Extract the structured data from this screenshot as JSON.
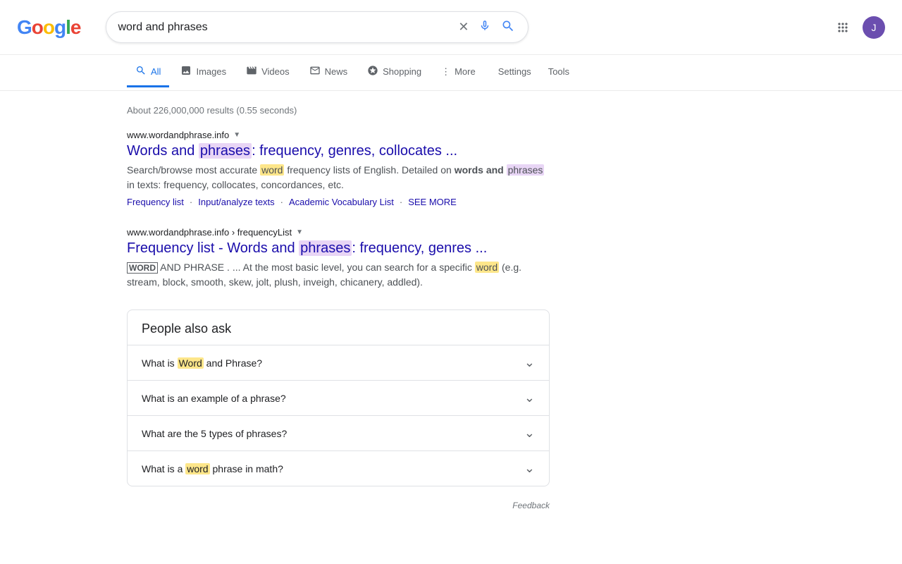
{
  "header": {
    "logo": "Google",
    "search_value": "word and phrases",
    "search_placeholder": "word and phrases"
  },
  "nav": {
    "tabs": [
      {
        "id": "all",
        "label": "All",
        "active": true,
        "icon": "search"
      },
      {
        "id": "images",
        "label": "Images",
        "active": false,
        "icon": "image"
      },
      {
        "id": "videos",
        "label": "Videos",
        "active": false,
        "icon": "video"
      },
      {
        "id": "news",
        "label": "News",
        "active": false,
        "icon": "newspaper"
      },
      {
        "id": "shopping",
        "label": "Shopping",
        "active": false,
        "icon": "tag"
      },
      {
        "id": "more",
        "label": "More",
        "active": false,
        "icon": "dots"
      }
    ],
    "settings_label": "Settings",
    "tools_label": "Tools"
  },
  "results": {
    "count_text": "About 226,000,000 results (0.55 seconds)",
    "items": [
      {
        "url": "www.wordandphrase.info",
        "has_dropdown": true,
        "title_parts": [
          "Words and ",
          "phrases",
          ": frequency, genres, collocates ..."
        ],
        "title_highlight": "phrases",
        "snippet_parts": [
          "Search/browse most accurate ",
          "word",
          " frequency lists of English. Detailed on ",
          "words and ",
          "phrases",
          " in texts: frequency, collocates, concordances, etc."
        ],
        "links": [
          "Frequency list",
          "Input/analyze texts",
          "Academic Vocabulary List",
          "SEE MORE"
        ]
      },
      {
        "url": "www.wordandphrase.info › frequencyList",
        "has_dropdown": true,
        "title_parts": [
          "Frequency list - Words and ",
          "phrases",
          ": frequency, genres ..."
        ],
        "title_highlight": "phrases",
        "snippet_label_word": "WORD",
        "snippet_label_phrase": "AND PHRASE",
        "snippet_body_parts": [
          ". ... At the most basic level, you can search for a specific ",
          "word",
          " (e.g. stream, block, smooth, skew, jolt, plush, inveigh, chicanery, addled)."
        ]
      }
    ]
  },
  "paa": {
    "title": "People also ask",
    "items": [
      {
        "text_parts": [
          "What is ",
          "Word",
          " and Phrase?"
        ],
        "highlight": "Word"
      },
      {
        "text": "What is an example of a phrase?"
      },
      {
        "text": "What are the 5 types of phrases?"
      },
      {
        "text_parts": [
          "What is a ",
          "word",
          " phrase in math?"
        ],
        "highlight": "word"
      }
    ]
  },
  "feedback": {
    "label": "Feedback"
  }
}
